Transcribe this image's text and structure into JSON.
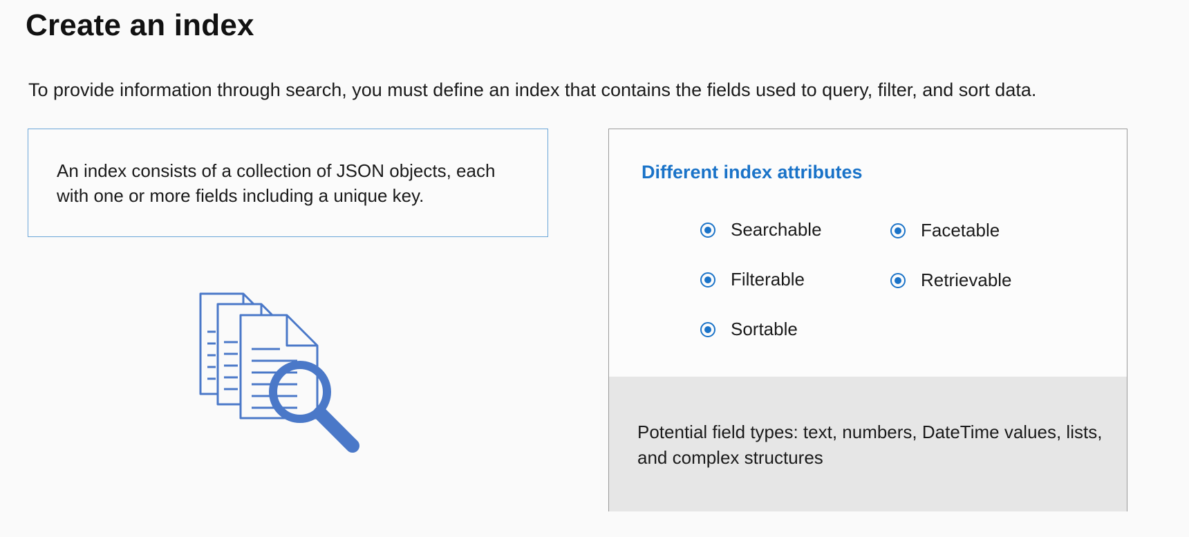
{
  "slide": {
    "title": "Create an index",
    "subtitle": "To provide information through search, you must define an index that contains the fields used to query, filter, and sort data."
  },
  "definition_box": {
    "text": "An index consists of a collection of JSON objects, each with one or more fields including a unique key."
  },
  "illustration": {
    "icon": "documents-magnifier-icon",
    "color": "#4a78c8"
  },
  "attributes_card": {
    "heading": "Different index attributes",
    "items": [
      {
        "label": "Searchable"
      },
      {
        "label": "Facetable"
      },
      {
        "label": "Filterable"
      },
      {
        "label": "Retrievable"
      },
      {
        "label": "Sortable"
      }
    ],
    "field_types_text": "Potential field types: text, numbers, DateTime values, lists, and complex structures"
  },
  "colors": {
    "accent": "#1a73c8",
    "box_border": "#6aa6d8",
    "panel_gray": "#e6e6e6"
  }
}
